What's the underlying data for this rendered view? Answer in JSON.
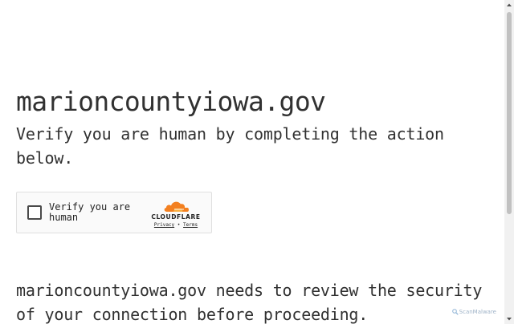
{
  "site": {
    "title": "marioncountyiowa.gov"
  },
  "challenge": {
    "verify_text": "Verify you are human by completing the action below.",
    "review_text": "marioncountyiowa.gov needs to review the security of your connection before proceeding."
  },
  "widget": {
    "checkbox_label": "Verify you are human",
    "brand": "CLOUDFLARE",
    "privacy_link": "Privacy",
    "separator": "•",
    "terms_link": "Terms",
    "brand_color": "#f38020"
  },
  "overlay": {
    "scanmalware": "ScanMalware"
  }
}
